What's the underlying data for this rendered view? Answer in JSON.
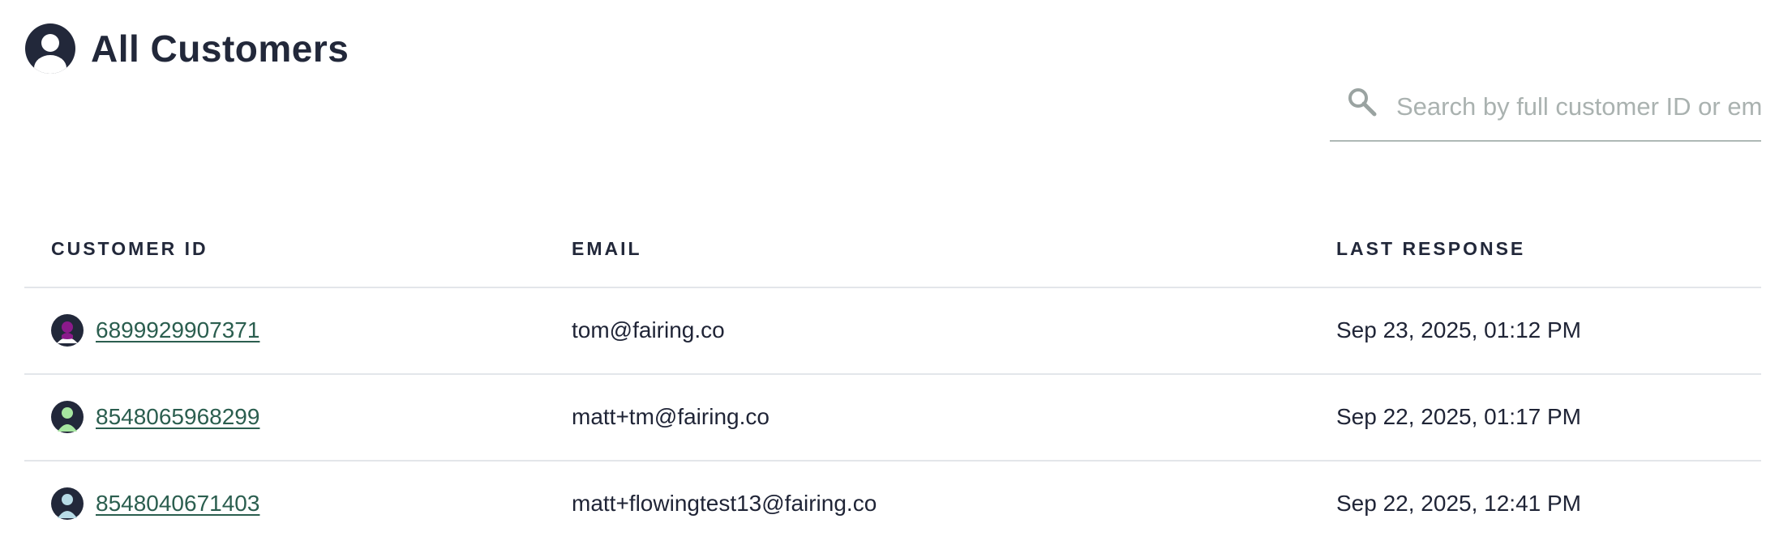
{
  "header": {
    "title": "All Customers",
    "icon": "user-icon"
  },
  "search": {
    "placeholder": "Search by full customer ID or email",
    "value": "",
    "icon": "search-icon"
  },
  "table": {
    "columns": [
      "CUSTOMER ID",
      "EMAIL",
      "LAST RESPONSE"
    ],
    "rows": [
      {
        "customer_id": "6899929907371",
        "email": "tom@fairing.co",
        "last_response": "Sep 23, 2025, 01:12 PM",
        "avatar_color": "#8b1a8b"
      },
      {
        "customer_id": "8548065968299",
        "email": "matt+tm@fairing.co",
        "last_response": "Sep 22, 2025, 01:17 PM",
        "avatar_color": "#a6e6a0"
      },
      {
        "customer_id": "8548040671403",
        "email": "matt+flowingtest13@fairing.co",
        "last_response": "Sep 22, 2025, 12:41 PM",
        "avatar_color": "#b7dbe6"
      }
    ]
  },
  "colors": {
    "text": "#1f2436",
    "link": "#2b5e4f",
    "divider": "#e3e6ea",
    "avatar_bg": "#22283a"
  }
}
